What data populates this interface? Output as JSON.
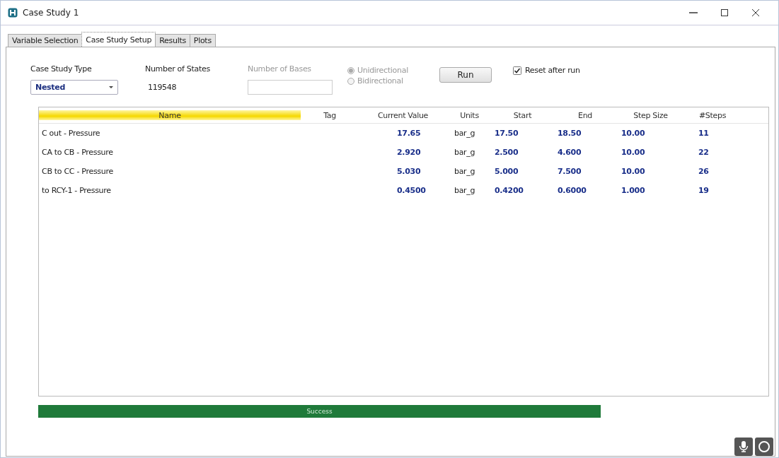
{
  "window": {
    "title": "Case Study 1"
  },
  "tabs": [
    {
      "label": "Variable Selection",
      "selected": false
    },
    {
      "label": "Case Study Setup",
      "selected": true
    },
    {
      "label": "Results",
      "selected": false
    },
    {
      "label": "Plots",
      "selected": false
    }
  ],
  "setup": {
    "case_study_type": {
      "label": "Case Study Type",
      "value": "Nested"
    },
    "number_of_states": {
      "label": "Number of States",
      "value": "119548"
    },
    "number_of_bases": {
      "label": "Number of Bases",
      "disabled": true
    },
    "direction": [
      {
        "label": "Unidirectional",
        "selected": true,
        "disabled": true
      },
      {
        "label": "Bidirectional",
        "selected": false,
        "disabled": true
      }
    ],
    "run_button": "Run",
    "reset_after_run": {
      "label": "Reset after run",
      "checked": true
    }
  },
  "table": {
    "columns": [
      "Name",
      "Tag",
      "Current Value",
      "Units",
      "Start",
      "End",
      "Step Size",
      "#Steps"
    ],
    "rows": [
      [
        "C out - Pressure",
        "",
        "17.65",
        "bar_g",
        "17.50",
        "18.50",
        "10.00",
        "11"
      ],
      [
        "CA to CB - Pressure",
        "",
        "2.920",
        "bar_g",
        "2.500",
        "4.600",
        "10.00",
        "22"
      ],
      [
        "CB to CC - Pressure",
        "",
        "5.030",
        "bar_g",
        "5.000",
        "7.500",
        "10.00",
        "26"
      ],
      [
        "to RCY-1 - Pressure",
        "",
        "0.4500",
        "bar_g",
        "0.4200",
        "0.6000",
        "1.000",
        "19"
      ]
    ]
  },
  "progress": {
    "level": 1,
    "text": "Success"
  }
}
